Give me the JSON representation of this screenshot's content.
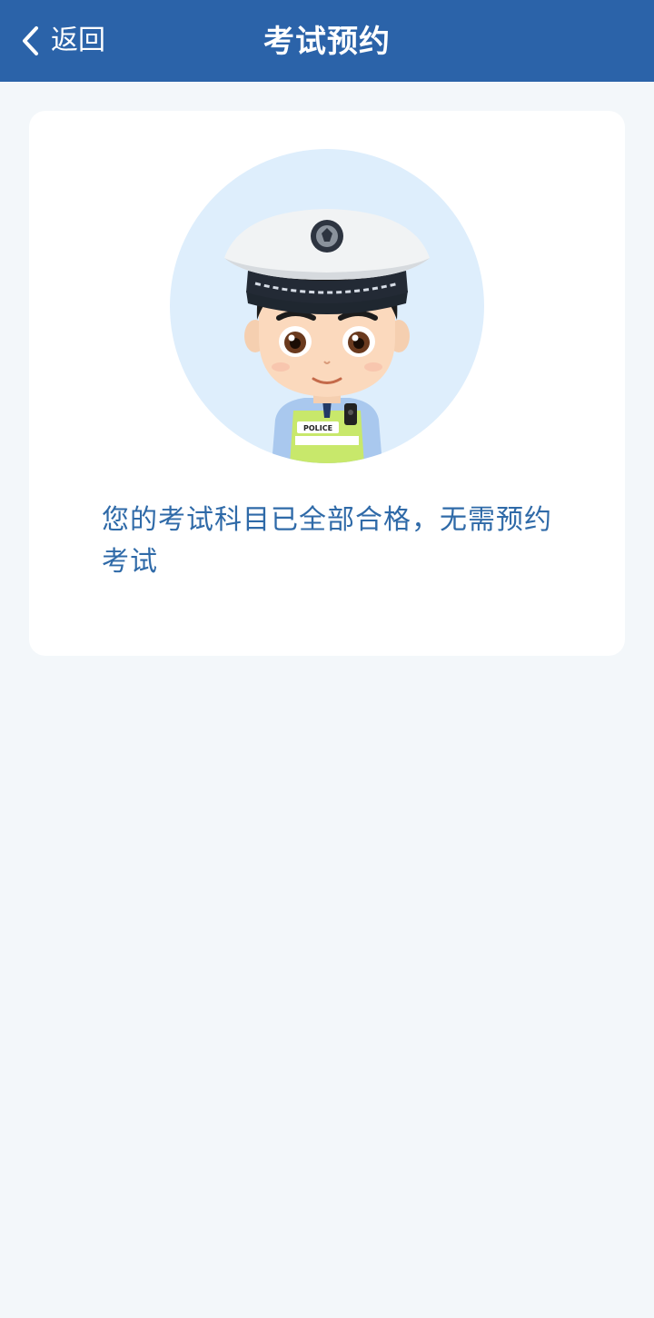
{
  "header": {
    "back_label": "返回",
    "title": "考试预约"
  },
  "notice": {
    "message": "您的考试科目已全部合格，无需预约考试"
  },
  "illustration": {
    "name": "police-officer-avatar",
    "badge_text": "POLICE"
  },
  "colors": {
    "nav_background": "#2b63a9",
    "page_background": "#f3f7fa",
    "card_background": "#ffffff",
    "message_text": "#2f6aa8",
    "avatar_circle": "#deeefc"
  },
  "icons": {
    "back": "chevron-left-icon"
  }
}
